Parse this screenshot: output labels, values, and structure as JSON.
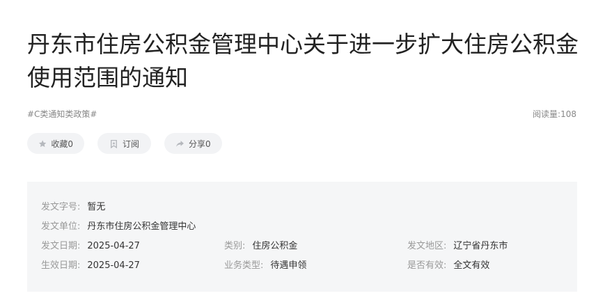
{
  "article": {
    "title": "丹东市住房公积金管理中心关于进一步扩大住房公积金使用范围的通知",
    "tag": "#C类通知类政策#",
    "read_count": "阅读量:108"
  },
  "actions": {
    "favorite_label": "收藏0",
    "subscribe_label": "订阅",
    "share_label": "分享0"
  },
  "info": {
    "doc_number_label": "发文字号:",
    "doc_number_value": "暂无",
    "issuer_label": "发文单位:",
    "issuer_value": "丹东市住房公积金管理中心",
    "issue_date_label": "发文日期:",
    "issue_date_value": "2025-04-27",
    "category_label": "类别:",
    "category_value": "住房公积金",
    "region_label": "发文地区:",
    "region_value": "辽宁省丹东市",
    "effective_date_label": "生效日期:",
    "effective_date_value": "2025-04-27",
    "business_type_label": "业务类型:",
    "business_type_value": "待遇申领",
    "valid_label": "是否有效:",
    "valid_value": "全文有效"
  },
  "icons": {
    "favorite": "star-icon",
    "subscribe": "bookmark-icon",
    "share": "share-arrow-icon"
  },
  "colors": {
    "background": "#ffffff",
    "panel": "#f5f6f7",
    "pill": "#f2f3f5",
    "title": "#222222",
    "muted": "#999999"
  }
}
